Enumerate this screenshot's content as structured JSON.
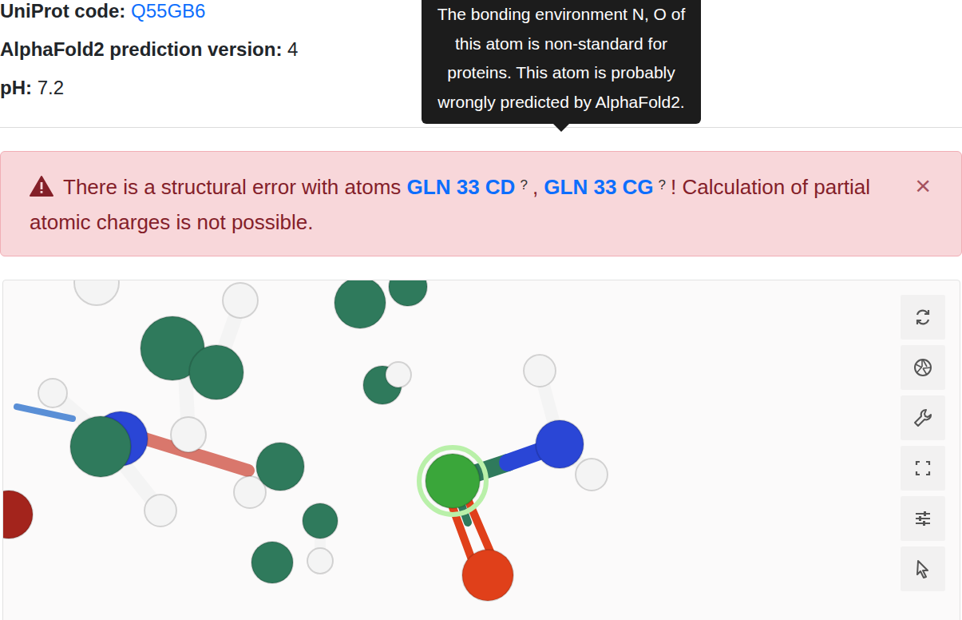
{
  "info": [
    {
      "label": "UniProt code:",
      "value": "Q55GB6",
      "link": true
    },
    {
      "label": "AlphaFold2 prediction version:",
      "value": "4",
      "link": false
    },
    {
      "label": "pH:",
      "value": "7.2",
      "link": false
    }
  ],
  "alert": {
    "prefix": "There is a structural error with atoms",
    "atoms": [
      {
        "label": "GLN 33 CD",
        "help": "?"
      },
      {
        "label": "GLN 33 CG",
        "help": "?"
      }
    ],
    "separator": ",",
    "suffix": "! Calculation of partial atomic charges is not possible.",
    "close": "×"
  },
  "tooltip": {
    "text": "The bonding environment N, O of this atom is non-standard for proteins. This atom is probably wrongly predicted by AlphaFold2."
  }
}
